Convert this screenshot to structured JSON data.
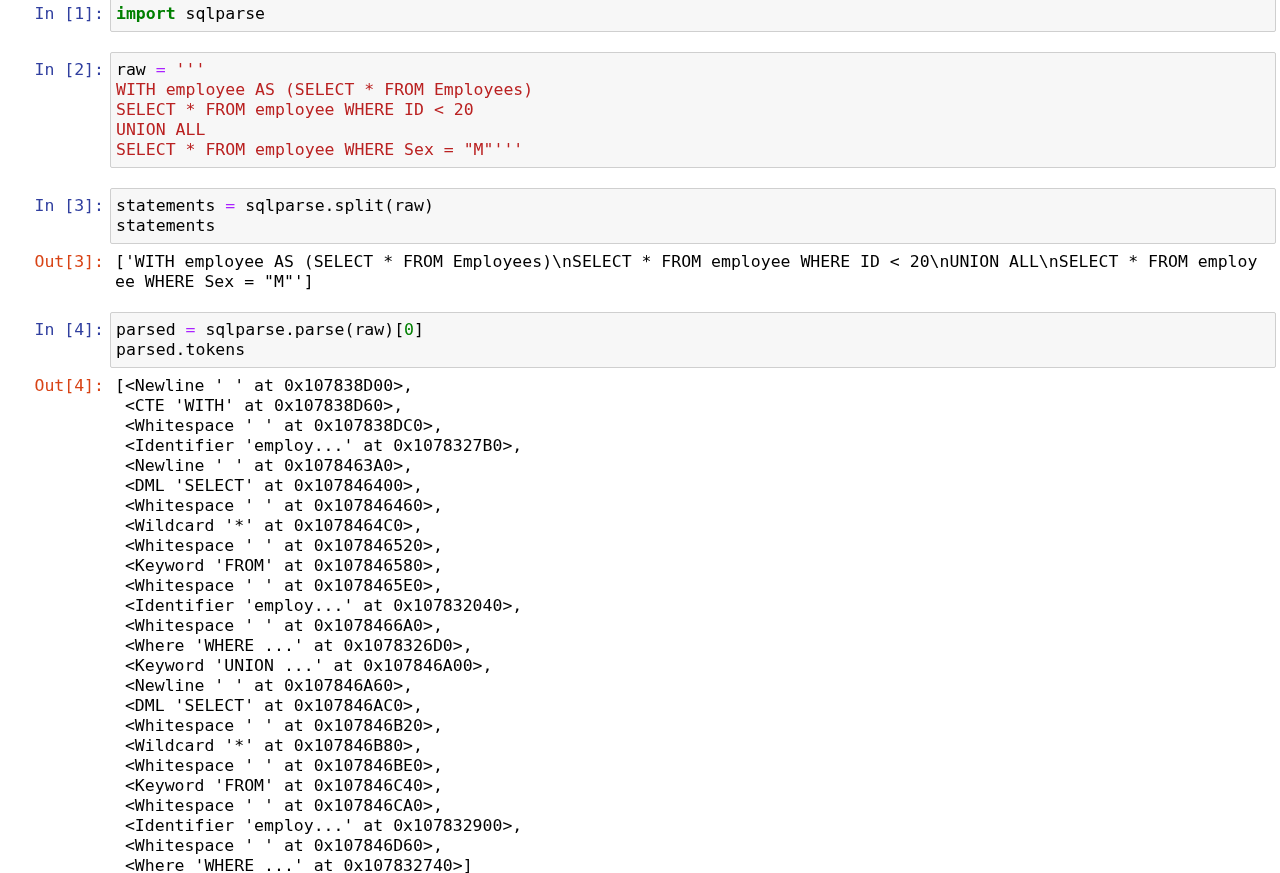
{
  "cells": [
    {
      "kind": "input",
      "prompt": "In [1]:",
      "lines": [
        [
          {
            "kind": "keyword",
            "text": "import"
          },
          {
            "kind": "plain",
            "text": " sqlparse"
          }
        ]
      ]
    },
    {
      "kind": "input",
      "prompt": "In [2]:",
      "lines": [
        [
          {
            "kind": "plain",
            "text": "raw "
          },
          {
            "kind": "operator",
            "text": "="
          },
          {
            "kind": "string",
            "text": " '''"
          }
        ],
        [
          {
            "kind": "string",
            "text": "WITH employee AS (SELECT * FROM Employees)"
          }
        ],
        [
          {
            "kind": "string",
            "text": "SELECT * FROM employee WHERE ID < 20"
          }
        ],
        [
          {
            "kind": "string",
            "text": "UNION ALL"
          }
        ],
        [
          {
            "kind": "string",
            "text": "SELECT * FROM employee WHERE Sex = \"M\"'''"
          }
        ]
      ]
    },
    {
      "kind": "input",
      "prompt": "In [3]:",
      "lines": [
        [
          {
            "kind": "plain",
            "text": "statements "
          },
          {
            "kind": "operator",
            "text": "="
          },
          {
            "kind": "plain",
            "text": " sqlparse.split(raw)"
          }
        ],
        [
          {
            "kind": "plain",
            "text": "statements"
          }
        ]
      ]
    },
    {
      "kind": "output",
      "prompt": "Out[3]:",
      "lines": [
        "['WITH employee AS (SELECT * FROM Employees)\\nSELECT * FROM employee WHERE ID < 20\\nUNION ALL\\nSELECT * FROM employ",
        "ee WHERE Sex = \"M\"']"
      ]
    },
    {
      "kind": "input",
      "prompt": "In [4]:",
      "lines": [
        [
          {
            "kind": "plain",
            "text": "parsed "
          },
          {
            "kind": "operator",
            "text": "="
          },
          {
            "kind": "plain",
            "text": " sqlparse.parse(raw)["
          },
          {
            "kind": "number",
            "text": "0"
          },
          {
            "kind": "plain",
            "text": "]"
          }
        ],
        [
          {
            "kind": "plain",
            "text": "parsed.tokens"
          }
        ]
      ]
    },
    {
      "kind": "output",
      "prompt": "Out[4]:",
      "lines": [
        "[<Newline ' ' at 0x107838D00>,",
        " <CTE 'WITH' at 0x107838D60>,",
        " <Whitespace ' ' at 0x107838DC0>,",
        " <Identifier 'employ...' at 0x1078327B0>,",
        " <Newline ' ' at 0x1078463A0>,",
        " <DML 'SELECT' at 0x107846400>,",
        " <Whitespace ' ' at 0x107846460>,",
        " <Wildcard '*' at 0x1078464C0>,",
        " <Whitespace ' ' at 0x107846520>,",
        " <Keyword 'FROM' at 0x107846580>,",
        " <Whitespace ' ' at 0x1078465E0>,",
        " <Identifier 'employ...' at 0x107832040>,",
        " <Whitespace ' ' at 0x1078466A0>,",
        " <Where 'WHERE ...' at 0x1078326D0>,",
        " <Keyword 'UNION ...' at 0x107846A00>,",
        " <Newline ' ' at 0x107846A60>,",
        " <DML 'SELECT' at 0x107846AC0>,",
        " <Whitespace ' ' at 0x107846B20>,",
        " <Wildcard '*' at 0x107846B80>,",
        " <Whitespace ' ' at 0x107846BE0>,",
        " <Keyword 'FROM' at 0x107846C40>,",
        " <Whitespace ' ' at 0x107846CA0>,",
        " <Identifier 'employ...' at 0x107832900>,",
        " <Whitespace ' ' at 0x107846D60>,",
        " <Where 'WHERE ...' at 0x107832740>]"
      ]
    }
  ]
}
